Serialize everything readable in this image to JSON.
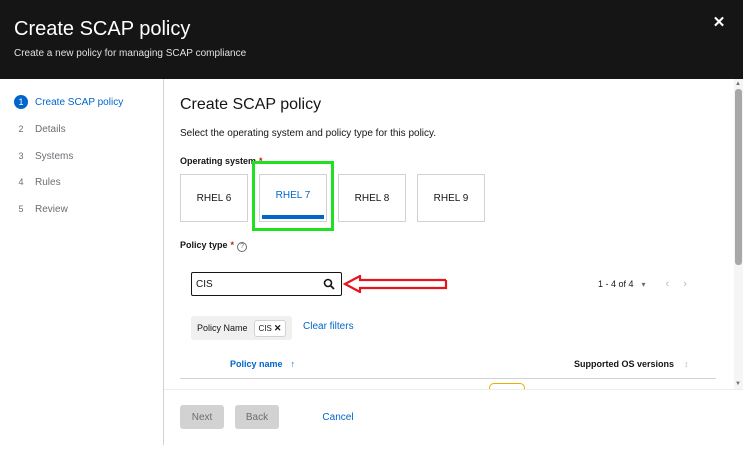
{
  "header": {
    "title": "Create SCAP policy",
    "subtitle": "Create a new policy for managing SCAP compliance",
    "close_icon": "close-icon"
  },
  "steps": [
    {
      "num": "1",
      "label": "Create SCAP policy",
      "active": true
    },
    {
      "num": "2",
      "label": "Details",
      "active": false
    },
    {
      "num": "3",
      "label": "Systems",
      "active": false
    },
    {
      "num": "4",
      "label": "Rules",
      "active": false
    },
    {
      "num": "5",
      "label": "Review",
      "active": false
    }
  ],
  "main": {
    "heading": "Create SCAP policy",
    "description": "Select the operating system and policy type for this policy.",
    "os_label": "Operating system",
    "required_marker": "*",
    "os_options": [
      "RHEL 6",
      "RHEL 7",
      "RHEL 8",
      "RHEL 9"
    ],
    "os_selected": "RHEL 7",
    "policy_type_label": "Policy type",
    "help_icon": "?",
    "search": {
      "value": "CIS",
      "icon": "search-icon"
    },
    "pagination": {
      "text": "1 - 4 of 4",
      "caret": "▾",
      "prev": "‹",
      "next": "›"
    },
    "filter": {
      "category": "Policy Name",
      "chip": "CIS",
      "chip_close": "✕",
      "clear": "Clear filters"
    },
    "table": {
      "col_name": "Policy name",
      "col_name_sort": "↑",
      "col_os": "Supported OS versions",
      "col_os_sort": "↕"
    }
  },
  "footer": {
    "next": "Next",
    "back": "Back",
    "cancel": "Cancel"
  },
  "colors": {
    "accent": "#0066cc",
    "highlight": "#21e021",
    "annotation_arrow": "#e8141b",
    "header_bg": "#151515"
  }
}
